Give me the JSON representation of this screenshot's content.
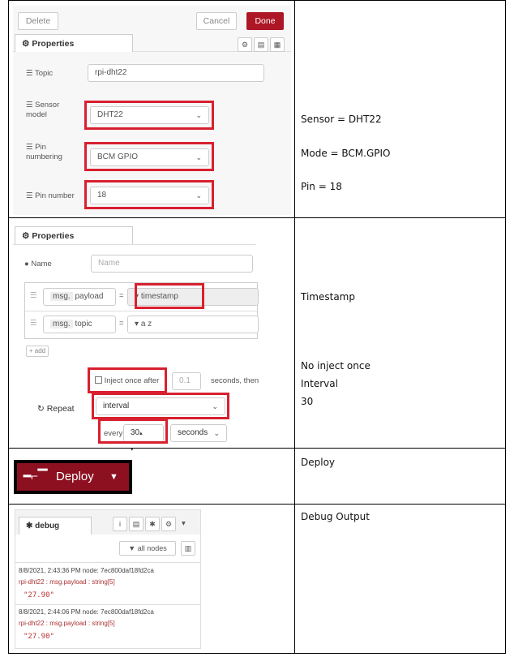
{
  "row1": {
    "buttons": {
      "delete": "Delete",
      "cancel": "Cancel",
      "done": "Done"
    },
    "tab": "Properties",
    "tab_icon": "gear-icon",
    "topic": {
      "label": "Topic",
      "value": "rpi-dht22"
    },
    "sensor_model": {
      "label_line1": "Sensor",
      "label_line2": "model",
      "value": "DHT22"
    },
    "pin_numbering": {
      "label_line1": "Pin",
      "label_line2": "numbering",
      "value": "BCM GPIO"
    },
    "pin_number": {
      "label": "Pin number",
      "value": "18"
    },
    "notes": {
      "sensor": "Sensor = DHT22",
      "mode": "Mode = BCM.GPIO",
      "pin": "Pin = 18"
    }
  },
  "row2": {
    "tab": "Properties",
    "name": {
      "label": "Name",
      "placeholder": "Name"
    },
    "props": [
      {
        "prefix": "msg.",
        "key": "payload",
        "value": "timestamp"
      },
      {
        "prefix": "msg.",
        "key": "topic",
        "value": "a z"
      }
    ],
    "add_label": "+ add",
    "inject_once": {
      "label": "Inject once after",
      "delay": "0.1",
      "suffix": "seconds, then"
    },
    "repeat": {
      "label": "Repeat",
      "value": "interval"
    },
    "every": {
      "label": "every",
      "value": "30",
      "unit": "seconds"
    },
    "notes": {
      "timestamp": "Timestamp",
      "no_inject": "No inject once",
      "interval": "Interval",
      "thirty": "30"
    }
  },
  "row3": {
    "deploy_label": "Deploy",
    "note": "Deploy"
  },
  "row4": {
    "tab": "debug",
    "filter": "all nodes",
    "messages": [
      {
        "meta": "8/8/2021, 2:43:36 PM   node: 7ec800daf18fd2ca",
        "topic": "rpi-dht22 : msg.payload : string[5]",
        "value": "\"27.90\""
      },
      {
        "meta": "8/8/2021, 2:44:06 PM   node: 7ec800daf18fd2ca",
        "topic": "rpi-dht22 : msg.payload : string[5]",
        "value": "\"27.90\""
      }
    ],
    "note": "Debug Output"
  }
}
